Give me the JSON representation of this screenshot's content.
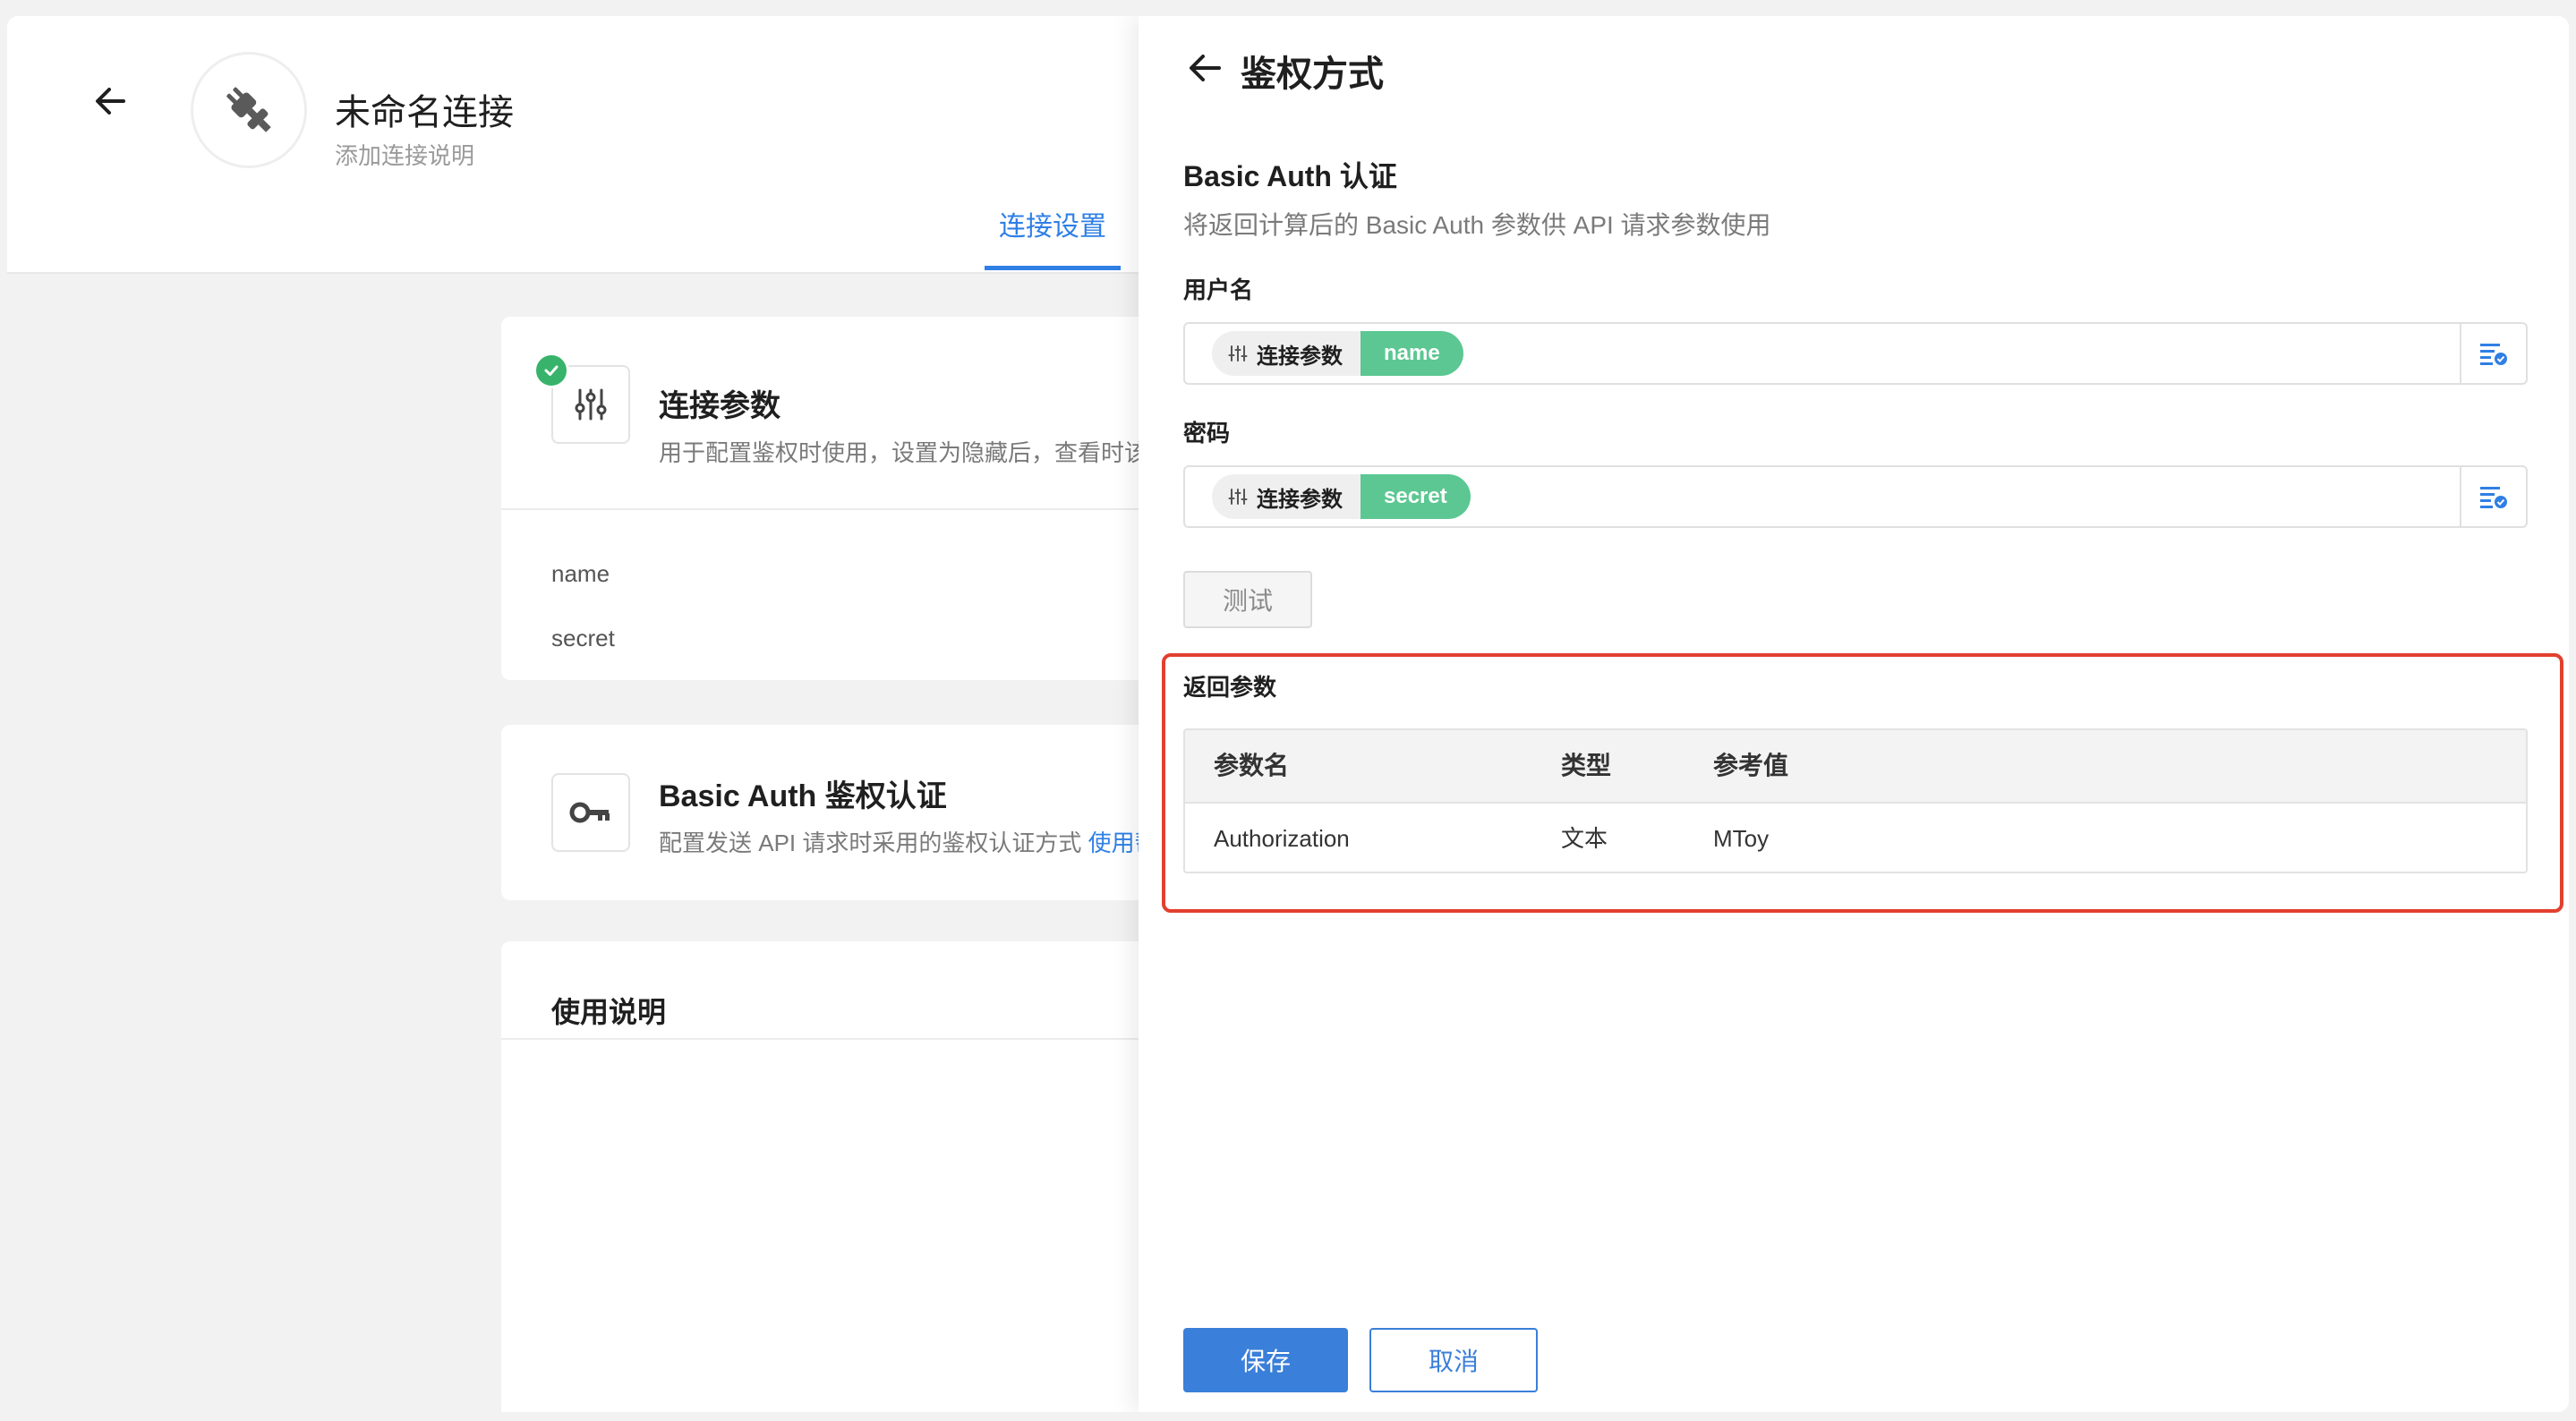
{
  "connection": {
    "title": "未命名连接",
    "description": "添加连接说明"
  },
  "tabs": {
    "active_label": "连接设置"
  },
  "params_card": {
    "title": "连接参数",
    "description": "用于配置鉴权时使用，设置为隐藏后，查看时该",
    "params": [
      "name",
      "secret"
    ]
  },
  "auth_card": {
    "title": "Basic Auth 鉴权认证",
    "description": "配置发送 API 请求时采用的鉴权认证方式",
    "help_link": "使用帮"
  },
  "usage_card": {
    "title": "使用说明"
  },
  "drawer": {
    "title": "鉴权方式",
    "section_title": "Basic Auth 认证",
    "section_desc": "将返回计算后的 Basic Auth 参数供 API 请求参数使用",
    "username": {
      "label": "用户名",
      "chip_source": "连接参数",
      "chip_value": "name"
    },
    "password": {
      "label": "密码",
      "chip_source": "连接参数",
      "chip_value": "secret"
    },
    "test_label": "测试",
    "return_title": "返回参数",
    "table": {
      "headers": [
        "参数名",
        "类型",
        "参考值"
      ],
      "rows": [
        [
          "Authorization",
          "文本",
          "MToy"
        ]
      ]
    },
    "save_label": "保存",
    "cancel_label": "取消"
  },
  "colors": {
    "accent": "#2f7fe5",
    "chip_green": "#5cc792",
    "highlight_red": "#e2402f",
    "check_green": "#38b36b"
  }
}
